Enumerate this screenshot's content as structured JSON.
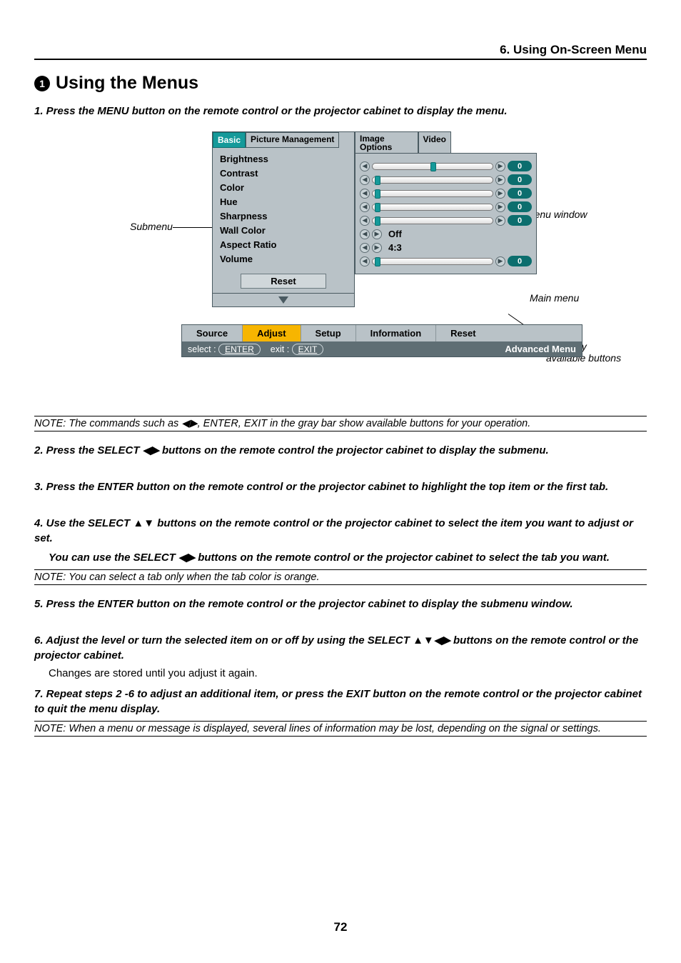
{
  "chapter": "6. Using On-Screen Menu",
  "section_num": "1",
  "section_title": "Using the Menus",
  "page_number": "72",
  "steps": {
    "s1": "1.  Press the MENU button on the remote control or the projector cabinet to display the menu.",
    "s2": "2.  Press the SELECT ◀▶ buttons on the remote control the projector cabinet to display the submenu.",
    "s3": "3.  Press the ENTER button on the remote control or the projector cabinet to highlight the top item or the first tab.",
    "s4": "4.  Use the SELECT ▲▼ buttons on the remote control or the projector cabinet to select the item you want to adjust or set.",
    "s4b": "You can use the SELECT ◀▶ buttons on the remote control or the projector cabinet to select the tab you want.",
    "s5": "5.  Press the ENTER button on the remote control or the projector cabinet to display the submenu window.",
    "s6": "6.  Adjust the level or turn the selected item on or off by using the SELECT ▲▼◀▶ buttons on the remote control or the projector cabinet.",
    "s6p": "Changes are stored until you adjust it again.",
    "s7": "7.  Repeat steps 2 -6 to adjust an additional item, or press the EXIT button on the remote control or the projector cabinet to quit the menu display."
  },
  "notes": {
    "n1": "NOTE: The commands such as ◀▶, ENTER, EXIT in the gray bar show available buttons for your operation.",
    "n2": "NOTE: You can select a tab only when the tab color is orange.",
    "n3": "NOTE: When a menu or message is displayed, several lines of information may be lost, depending on the signal or settings."
  },
  "figure": {
    "annot_submenu": "Submenu",
    "annot_subwindow": "Submenu window",
    "annot_mainmenu": "Main menu",
    "annot_buttons": "Currently available buttons",
    "tabs": {
      "basic": "Basic",
      "picmgmt": "Picture Management",
      "imgopt": "Image Options",
      "video": "Video"
    },
    "items": {
      "brightness": "Brightness",
      "contrast": "Contrast",
      "color": "Color",
      "hue": "Hue",
      "sharpness": "Sharpness",
      "wallcolor": "Wall Color",
      "aspect": "Aspect Ratio",
      "volume": "Volume"
    },
    "reset": "Reset",
    "values": {
      "zero": "0",
      "off": "Off",
      "ar": "4:3"
    },
    "mainmenu": {
      "source": "Source",
      "adjust": "Adjust",
      "setup": "Setup",
      "information": "Information",
      "reset": "Reset",
      "select_label": "select :",
      "enter": "ENTER",
      "exit_label": "exit :",
      "exit": "EXIT",
      "advanced": "Advanced Menu"
    }
  }
}
